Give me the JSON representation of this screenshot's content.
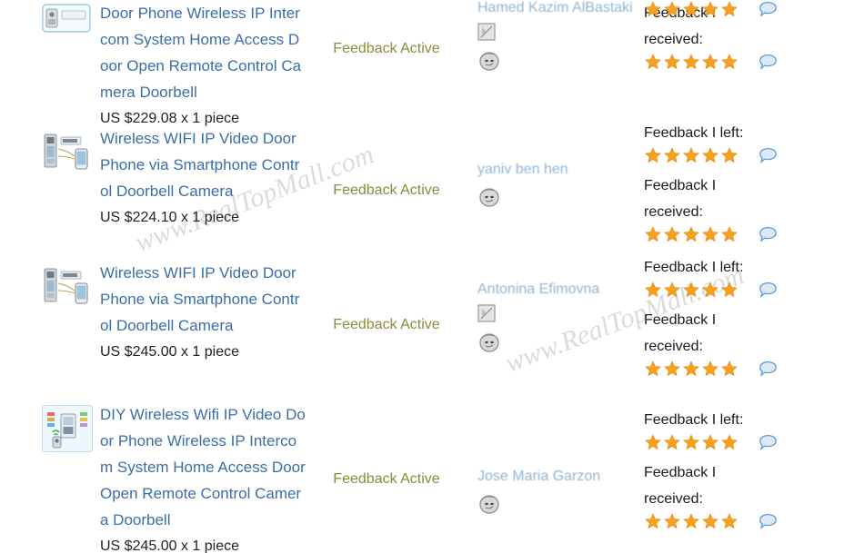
{
  "watermark": {
    "text": "www.RealTopMall.com",
    "color": "#c8c8c8",
    "instances": 2
  },
  "colors": {
    "product_link": "#3b6ea5",
    "price_text": "#222222",
    "status_text": "#8a8a3a",
    "buyer_link": "#8fb4d4",
    "star_fill": "#f5a01e",
    "bubble_stroke": "#5a9bd5",
    "thumb_border": "#bcd9ea"
  },
  "labels": {
    "feedback_left": "Feedback I left:",
    "feedback_received_line1": "Feedback I",
    "feedback_received_line2": "received:",
    "status_active": "Feedback Active"
  },
  "icons": {
    "avatar": "avatar-face-icon",
    "broken_image": "broken-image-icon",
    "speech_bubble": "speech-bubble-icon",
    "star": "star-icon"
  },
  "rows": [
    {
      "product": {
        "thumbnail": "door-phone-intercom-thumbnail",
        "framed": false,
        "title": "Door Phone Wireless IP Intercom System Home Access Door Open Remote Control Camera Doorbell",
        "price": "US $229.08 x 1 piece"
      },
      "status": "Feedback Active",
      "buyer": {
        "name": "Hamed Kazim AlBastaki",
        "has_broken_image": true,
        "has_avatar": true
      },
      "feedback": {
        "left_label": "Feedback I left:",
        "left_stars": 5,
        "received_label_line1": "Feedback I",
        "received_label_line2": "received:",
        "received_stars": 5
      }
    },
    {
      "product": {
        "thumbnail": "wifi-video-door-phone-thumbnail",
        "framed": false,
        "title": "Wireless WIFI IP Video Door Phone via Smartphone Control Doorbell Camera",
        "price": "US $224.10 x 1 piece"
      },
      "status": "Feedback Active",
      "buyer": {
        "name": "yaniv ben hen",
        "has_broken_image": false,
        "has_avatar": true
      },
      "feedback": {
        "left_label": "Feedback I left:",
        "left_stars": 5,
        "received_label_line1": "Feedback I",
        "received_label_line2": "received:",
        "received_stars": 5
      }
    },
    {
      "product": {
        "thumbnail": "wifi-video-door-phone-thumbnail",
        "framed": false,
        "title": "Wireless WIFI IP Video Door Phone via Smartphone Control Doorbell Camera",
        "price": "US $245.00 x 1 piece"
      },
      "status": "Feedback Active",
      "buyer": {
        "name": "Antonina Efimovna",
        "has_broken_image": true,
        "has_avatar": true
      },
      "feedback": {
        "left_label": "Feedback I left:",
        "left_stars": 5,
        "received_label_line1": "Feedback I",
        "received_label_line2": "received:",
        "received_stars": 5
      }
    },
    {
      "product": {
        "thumbnail": "diy-wifi-video-door-phone-thumbnail",
        "framed": true,
        "title": "DIY Wireless Wifi IP Video Door Phone Wireless IP Intercom System Home Access Door Open Remote Control Camera Doorbell",
        "price": "US $245.00 x 1 piece"
      },
      "status": "Feedback Active",
      "buyer": {
        "name": "Jose Maria Garzon",
        "has_broken_image": false,
        "has_avatar": true
      },
      "feedback": {
        "left_label": "Feedback I left:",
        "left_stars": 5,
        "received_label_line1": "Feedback I",
        "received_label_line2": "received:",
        "received_stars": 5
      }
    }
  ]
}
